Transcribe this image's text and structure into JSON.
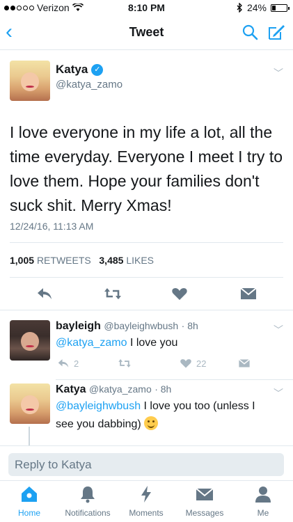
{
  "status_bar": {
    "carrier": "Verizon",
    "time": "8:10 PM",
    "battery": "24%",
    "battery_level": 0.24
  },
  "nav": {
    "title": "Tweet"
  },
  "tweet": {
    "name": "Katya",
    "handle": "@katya_zamo",
    "text": "I love everyone in my life a lot, all the time everyday. Everyone I meet I try to love them. Hope your families don't suck shit. Merry Xmas!",
    "date": "12/24/16, 11:13 AM",
    "retweets_count": "1,005",
    "retweets_label": "RETWEETS",
    "likes_count": "3,485",
    "likes_label": "LIKES"
  },
  "replies": [
    {
      "name": "bayleigh",
      "handle": "@bayleighwbush",
      "time": "· 8h",
      "mention": "@katya_zamo",
      "text": " I love you",
      "reply_count": "2",
      "like_count": "22"
    },
    {
      "name": "Katya",
      "handle": "@katya_zamo",
      "time": "· 8h",
      "mention": "@bayleighwbush",
      "text": " I love you too (unless I see you dabbing) "
    }
  ],
  "reply_bar": {
    "placeholder": "Reply to Katya"
  },
  "tabs": [
    {
      "label": "Home",
      "active": true
    },
    {
      "label": "Notifications",
      "active": false
    },
    {
      "label": "Moments",
      "active": false
    },
    {
      "label": "Messages",
      "active": false
    },
    {
      "label": "Me",
      "active": false
    }
  ],
  "colors": {
    "accent": "#1da1f2",
    "secondary_text": "#657786",
    "icon_gray": "#aab8c2"
  }
}
